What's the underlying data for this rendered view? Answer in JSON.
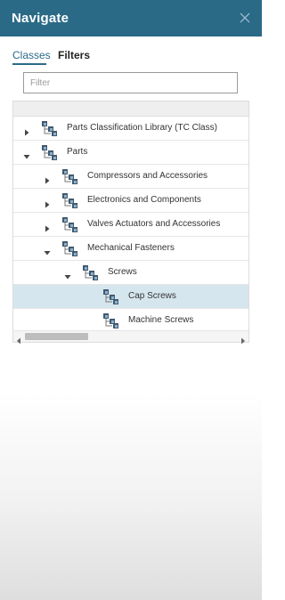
{
  "header": {
    "title": "Navigate",
    "close_icon": "close-icon"
  },
  "tabs": [
    {
      "label": "Classes",
      "active": true
    },
    {
      "label": "Filters",
      "active": false
    }
  ],
  "filter": {
    "placeholder": "Filter",
    "value": ""
  },
  "tree": {
    "rows": [
      {
        "label": "Parts Classification Library (TC Class)",
        "level": 0,
        "state": "collapsed",
        "selected": false
      },
      {
        "label": "Parts",
        "level": 0,
        "state": "expanded",
        "selected": false
      },
      {
        "label": "Compressors and Accessories",
        "level": 1,
        "state": "collapsed",
        "selected": false
      },
      {
        "label": "Electronics and Components",
        "level": 1,
        "state": "collapsed",
        "selected": false
      },
      {
        "label": "Valves Actuators and Accessories",
        "level": 1,
        "state": "collapsed",
        "selected": false
      },
      {
        "label": "Mechanical Fasteners",
        "level": 1,
        "state": "expanded",
        "selected": false
      },
      {
        "label": "Screws",
        "level": 2,
        "state": "expanded",
        "selected": false
      },
      {
        "label": "Cap Screws",
        "level": 3,
        "state": "leaf",
        "selected": true
      },
      {
        "label": "Machine Screws",
        "level": 3,
        "state": "leaf",
        "selected": false
      }
    ]
  },
  "colors": {
    "header_bg": "#2a6a87",
    "accent": "#2a6a87",
    "selected_row": "#d6e6ee",
    "icon_dark": "#3f5a72",
    "icon_light": "#8fb0c8"
  }
}
